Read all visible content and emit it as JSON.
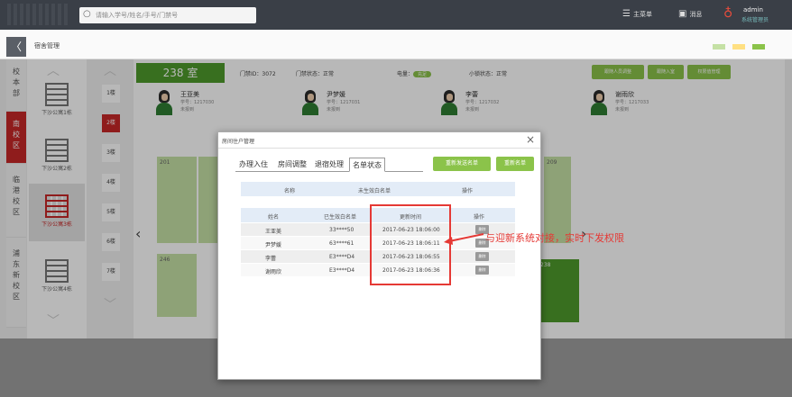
{
  "topbar": {
    "search_placeholder": "请输入学号/姓名/手号/门禁号",
    "items": [
      {
        "icon": "menu-icon",
        "label": "主菜单"
      },
      {
        "icon": "message-icon",
        "label": "消息"
      }
    ],
    "user_name": "admin",
    "user_role": "系统管理员"
  },
  "subbar": {
    "back_label": "〈",
    "breadcrumb": "宿舍管理"
  },
  "campuses": [
    {
      "label": "校\n本\n部",
      "active": false
    },
    {
      "label": "南\n校\n区",
      "active": true
    },
    {
      "label": "临\n港\n校\n区",
      "active": false
    },
    {
      "label": "浦\n东\n新\n校\n区",
      "active": false
    }
  ],
  "dorms": [
    {
      "label": "下沙公寓1栋",
      "active": false
    },
    {
      "label": "下沙公寓2栋",
      "active": false
    },
    {
      "label": "下沙公寓3栋",
      "active": true
    },
    {
      "label": "下沙公寓4栋",
      "active": false
    }
  ],
  "floors": [
    {
      "label": "1楼",
      "active": false
    },
    {
      "label": "2楼",
      "active": true
    },
    {
      "label": "3楼",
      "active": false
    },
    {
      "label": "4楼",
      "active": false
    },
    {
      "label": "5楼",
      "active": false
    },
    {
      "label": "6楼",
      "active": false
    },
    {
      "label": "7楼",
      "active": false
    }
  ],
  "room": {
    "title": "238 室",
    "door_id": "门禁ID：3072",
    "door_status": "门禁状态：正常",
    "power_label": "电量：",
    "power_value": "充足",
    "lock_status": "小锁状态：正常",
    "actions": [
      "跟随人员调整",
      "跟随入室",
      "权限值管理"
    ],
    "residents": [
      {
        "name": "王亚美",
        "line1": "学号：1217030",
        "line2": "未报到"
      },
      {
        "name": "尹梦媛",
        "line1": "学号：1217031",
        "line2": "未报到"
      },
      {
        "name": "李蕾",
        "line1": "学号：1217032",
        "line2": "未报到"
      },
      {
        "name": "谢雨欣",
        "line1": "学号：1217033",
        "line2": "未报到"
      }
    ],
    "bed_labels": [
      "201",
      "209",
      "246",
      "238"
    ]
  },
  "modal": {
    "title": "房间住户管理",
    "tabs": [
      "办理入住",
      "房间调整",
      "退宿处理",
      "名单状态"
    ],
    "active_tab": "名单状态",
    "buttons": [
      "重新发送名单",
      "重新名单"
    ],
    "table1_headers": [
      "名称",
      "未生效白名单",
      "操作"
    ],
    "table2_headers": [
      "姓名",
      "已生效白名单",
      "更新时间",
      "操作"
    ],
    "rows": [
      {
        "name": "王亚美",
        "code": "33****50",
        "time": "2017-06-23 18:06:00",
        "op": "删除"
      },
      {
        "name": "尹梦媛",
        "code": "63****61",
        "time": "2017-06-23 18:06:11",
        "op": "删除"
      },
      {
        "name": "李蕾",
        "code": "E3****D4",
        "time": "2017-06-23 18:06:55",
        "op": "删除"
      },
      {
        "name": "谢雨欣",
        "code": "E3****D4",
        "time": "2017-06-23 18:06:36",
        "op": "删除"
      }
    ]
  },
  "annotation": "与迎新系统对接，实时下发权限",
  "colors": {
    "accent_green": "#8bc34a",
    "brand_red": "#c62828",
    "annotation_red": "#e53935"
  }
}
